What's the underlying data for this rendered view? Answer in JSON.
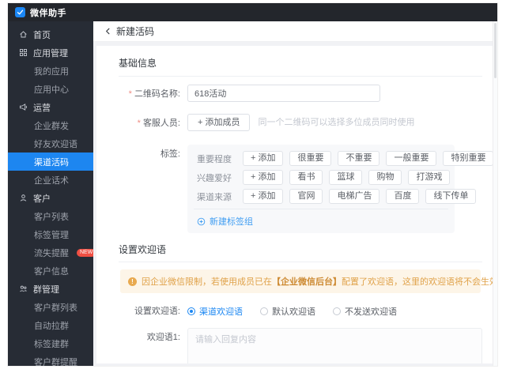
{
  "topbar": {
    "logo_text": "微伴助手"
  },
  "sidebar": {
    "items": [
      {
        "id": "home",
        "label": "首页",
        "type": "top",
        "icon": "home-icon"
      },
      {
        "id": "app-management",
        "label": "应用管理",
        "type": "section",
        "icon": "apps-icon"
      },
      {
        "id": "my-apps",
        "label": "我的应用",
        "type": "sub"
      },
      {
        "id": "app-center",
        "label": "应用中心",
        "type": "sub"
      },
      {
        "id": "operations",
        "label": "运营",
        "type": "section",
        "icon": "operations-icon"
      },
      {
        "id": "enterprise-mass-send",
        "label": "企业群发",
        "type": "sub"
      },
      {
        "id": "friend-welcome",
        "label": "好友欢迎语",
        "type": "sub"
      },
      {
        "id": "channel-live-code",
        "label": "渠道活码",
        "type": "sub",
        "active": true
      },
      {
        "id": "enterprise-scripts",
        "label": "企业话术",
        "type": "sub"
      },
      {
        "id": "customer",
        "label": "客户",
        "type": "section",
        "icon": "customer-icon"
      },
      {
        "id": "customer-list",
        "label": "客户列表",
        "type": "sub"
      },
      {
        "id": "tag-management",
        "label": "标签管理",
        "type": "sub"
      },
      {
        "id": "churn-reminder",
        "label": "流失提醒",
        "type": "sub",
        "badge": "NEW"
      },
      {
        "id": "customer-info",
        "label": "客户信息",
        "type": "sub"
      },
      {
        "id": "group-management",
        "label": "群管理",
        "type": "section",
        "icon": "group-icon"
      },
      {
        "id": "customer-group-list",
        "label": "客户群列表",
        "type": "sub"
      },
      {
        "id": "auto-pull-group",
        "label": "自动拉群",
        "type": "sub"
      },
      {
        "id": "tag-build-group",
        "label": "标签建群",
        "type": "sub"
      },
      {
        "id": "customer-group-reminder",
        "label": "客户群提醒",
        "type": "sub"
      }
    ]
  },
  "header": {
    "title": "新建活码"
  },
  "basic_info": {
    "title": "基础信息",
    "qr_name": {
      "label": "二维码名称:",
      "value": "618活动"
    },
    "staff": {
      "label": "客服人员:",
      "add_button": "+ 添加成员",
      "hint": "同一个二维码可以选择多位成员同时使用"
    },
    "tags_label": "标签:",
    "tag_groups": [
      {
        "name": "重要程度",
        "add_label": "+ 添加",
        "tags": [
          "很重要",
          "不重要",
          "一般重要",
          "特别重要"
        ]
      },
      {
        "name": "兴趣爱好",
        "add_label": "+ 添加",
        "tags": [
          "看书",
          "篮球",
          "购物",
          "打游戏"
        ]
      },
      {
        "name": "渠道来源",
        "add_label": "+ 添加",
        "tags": [
          "官网",
          "电梯广告",
          "百度",
          "线下传单"
        ]
      }
    ],
    "new_tag_group": "新建标签组"
  },
  "welcome": {
    "title": "设置欢迎语",
    "warning": {
      "pre": "因企业微信限制，若使用成员已在",
      "strong": "【企业微信后台】",
      "post": "配置了欢迎语，这里的欢迎语将不会生效"
    },
    "mode": {
      "label": "设置欢迎语:",
      "options": [
        {
          "id": "channel-welcome",
          "label": "渠道欢迎语",
          "selected": true
        },
        {
          "id": "default-welcome",
          "label": "默认欢迎语",
          "selected": false
        },
        {
          "id": "no-welcome",
          "label": "不发送欢迎语",
          "selected": false
        }
      ]
    },
    "message1": {
      "label": "欢迎语1:",
      "placeholder": "请输入回复内容"
    }
  },
  "colors": {
    "accent_blue": "#1b87f5",
    "sidebar_active": "#1d86f0",
    "warning_bg": "#fdf5e8",
    "warning_text": "#e0a24a",
    "badge_red": "#f04f43"
  }
}
